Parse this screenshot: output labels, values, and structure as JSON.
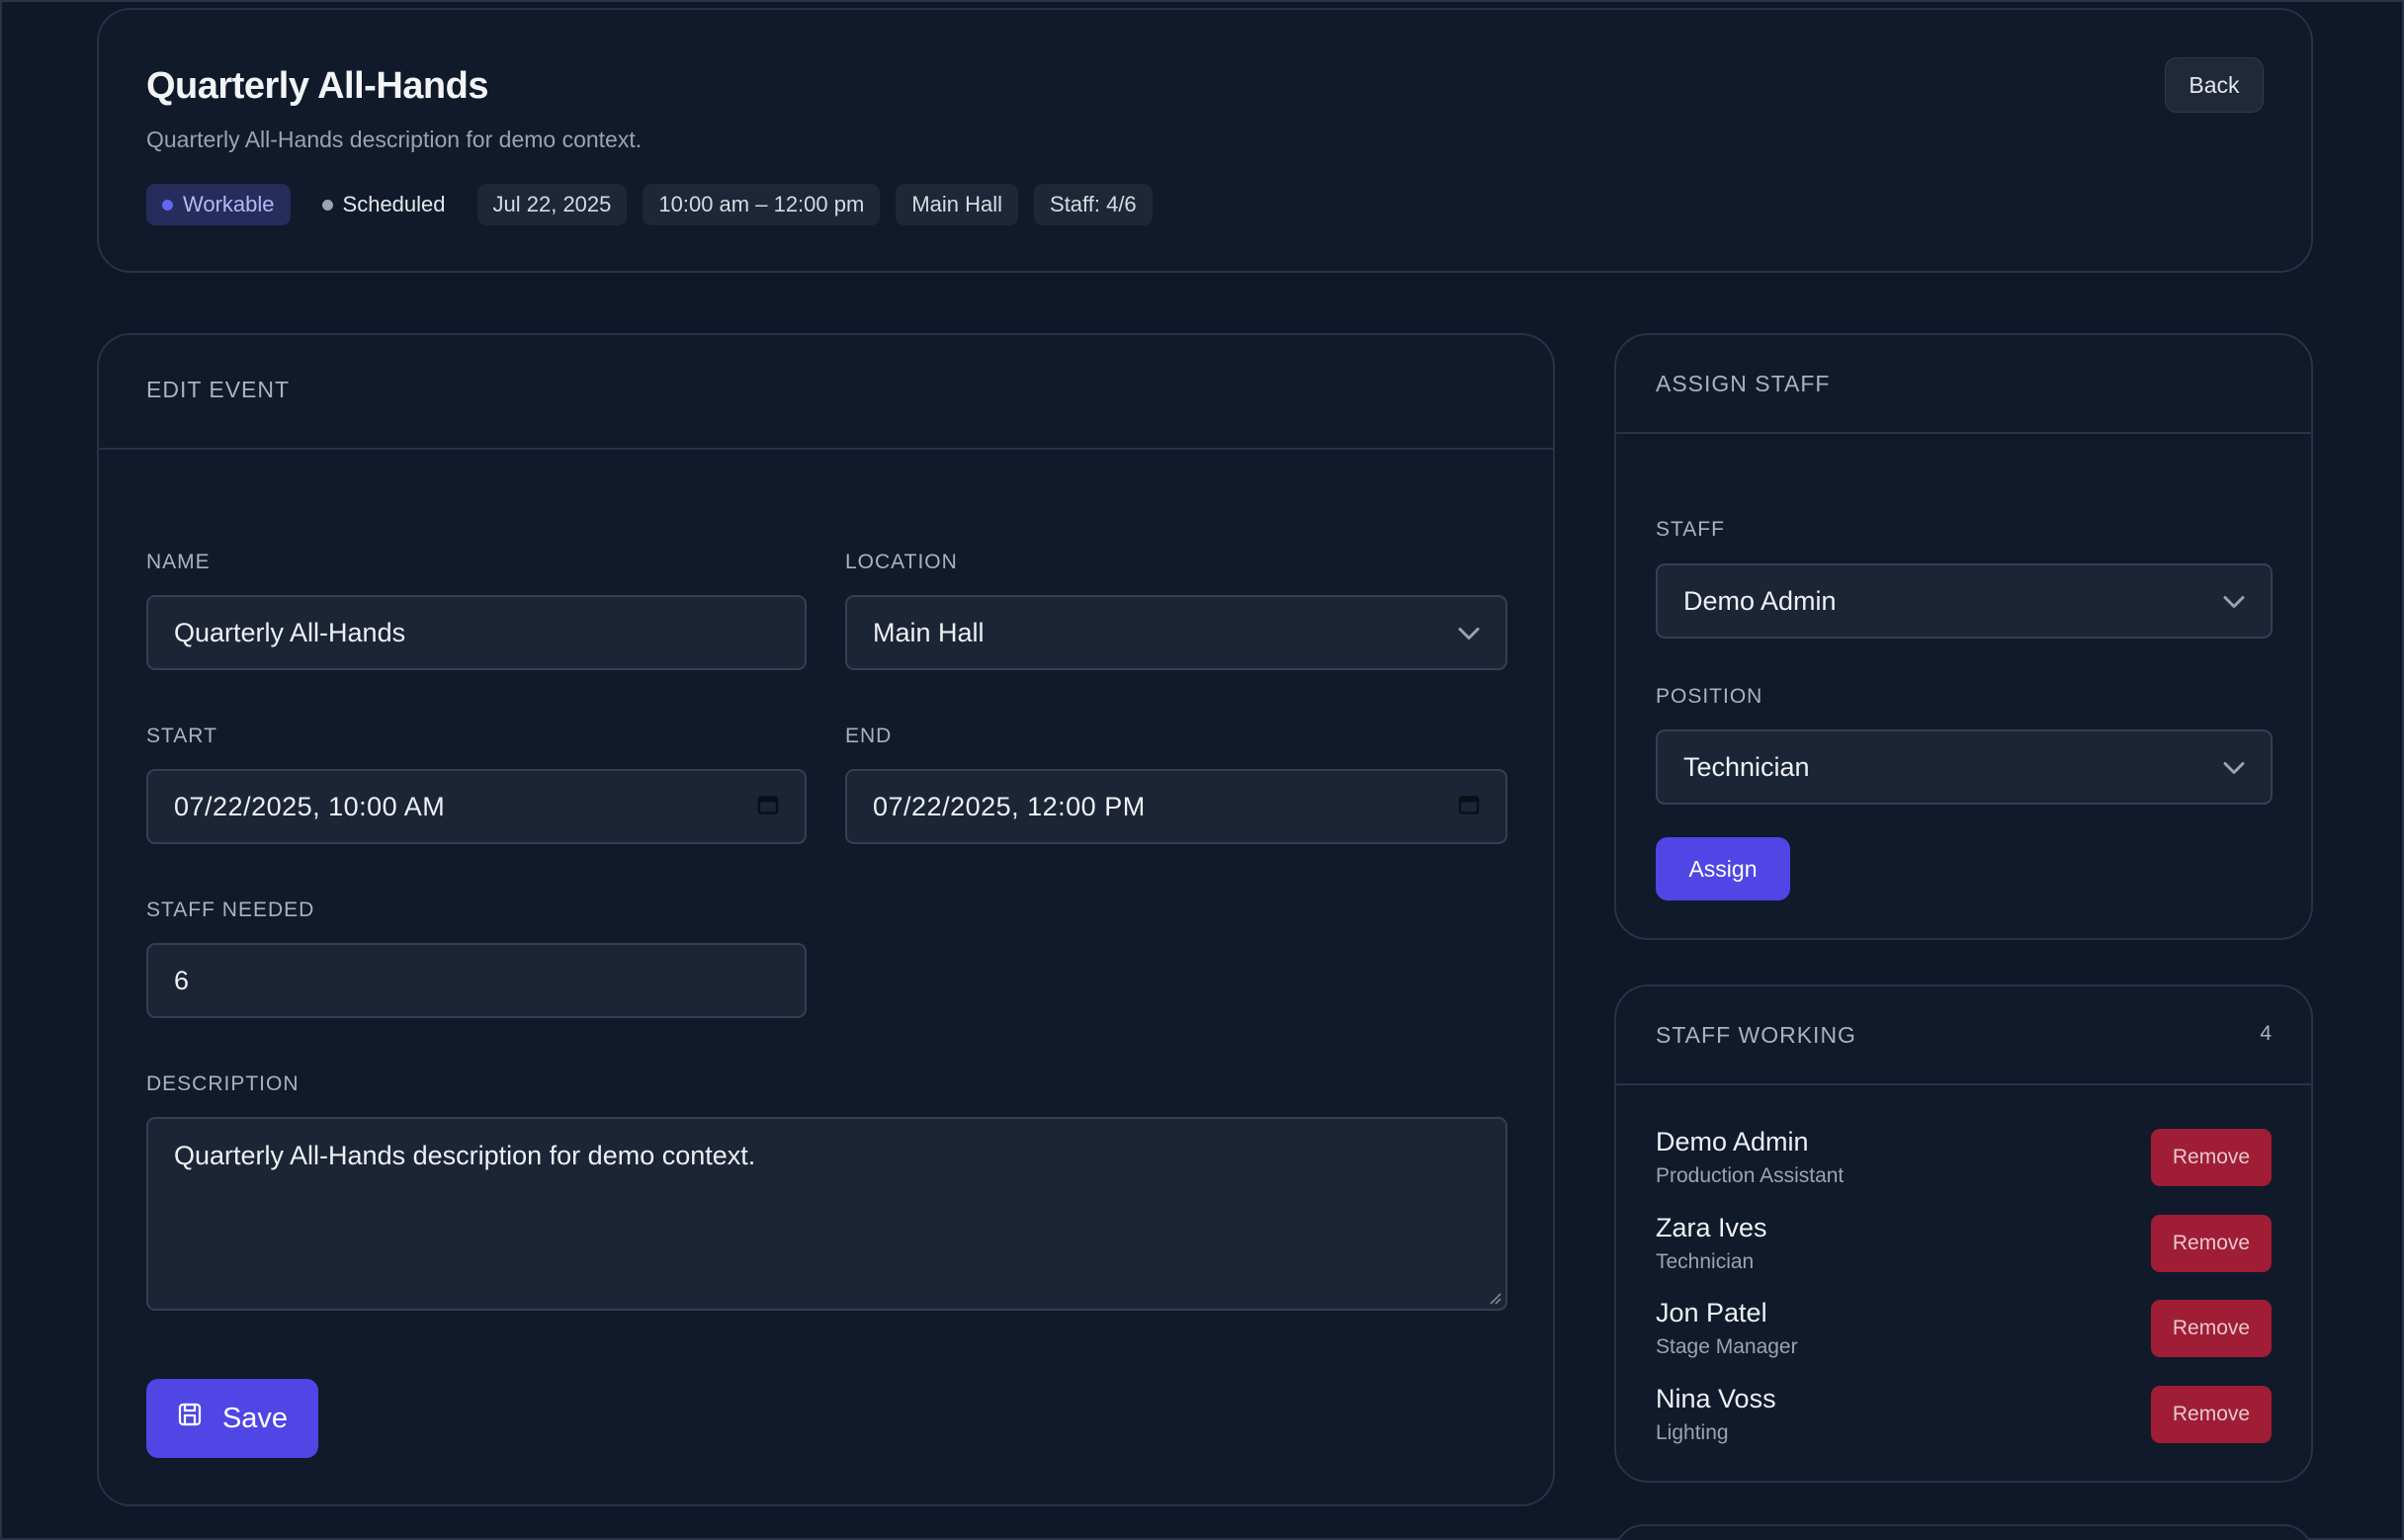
{
  "header": {
    "title": "Quarterly All-Hands",
    "subtitle": "Quarterly All-Hands description for demo context.",
    "back_label": "Back",
    "chips": {
      "workable": "Workable",
      "status": "Scheduled",
      "date": "Jul 22, 2025",
      "time": "10:00 am – 12:00 pm",
      "location": "Main Hall",
      "staff": "Staff: 4/6"
    }
  },
  "edit": {
    "title": "EDIT EVENT",
    "name_label": "NAME",
    "name_value": "Quarterly All-Hands",
    "location_label": "LOCATION",
    "location_value": "Main Hall",
    "start_label": "START",
    "start_value": "07/22/2025, 10:00 AM",
    "end_label": "END",
    "end_value": "07/22/2025, 12:00 PM",
    "staff_needed_label": "STAFF NEEDED",
    "staff_needed_value": "6",
    "description_label": "DESCRIPTION",
    "description_value": "Quarterly All-Hands description for demo context.",
    "save_label": "Save"
  },
  "assign": {
    "title": "ASSIGN STAFF",
    "staff_label": "STAFF",
    "staff_value": "Demo Admin",
    "position_label": "POSITION",
    "position_value": "Technician",
    "assign_label": "Assign"
  },
  "working": {
    "title": "STAFF WORKING",
    "count": "4",
    "remove_label": "Remove",
    "staff": [
      {
        "name": "Demo Admin",
        "role": "Production Assistant"
      },
      {
        "name": "Zara Ives",
        "role": "Technician"
      },
      {
        "name": "Jon Patel",
        "role": "Stage Manager"
      },
      {
        "name": "Nina Voss",
        "role": "Lighting"
      }
    ]
  },
  "colors": {
    "background": "#0f1728",
    "card": "#111a2b",
    "accent": "#4f46e5",
    "danger": "#9f1d35",
    "workable_dot": "#6366f1",
    "scheduled_dot": "#9ca3af"
  }
}
